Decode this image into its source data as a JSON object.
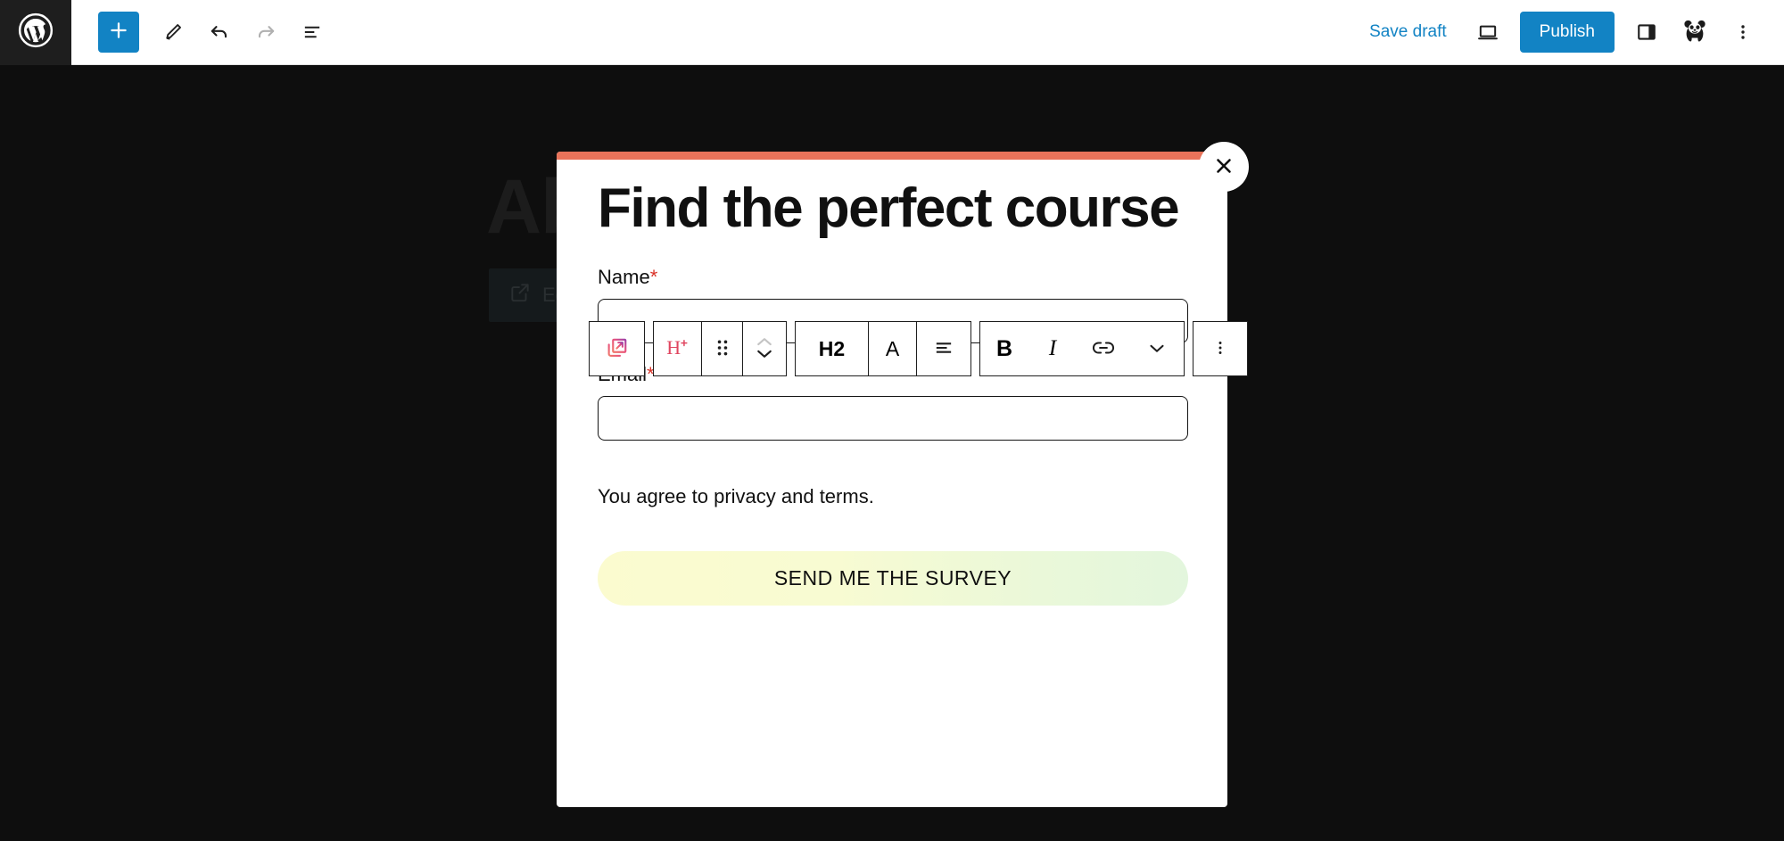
{
  "admin_bar": {
    "logo_icon": "wordpress-logo-icon",
    "add_block_label": "+",
    "add_block_icon": "plus-icon",
    "tools": [
      {
        "name": "edit-tool-button",
        "icon": "pencil-icon",
        "title": "Tools"
      },
      {
        "name": "undo-button",
        "icon": "undo-arrow-icon",
        "title": "Undo"
      },
      {
        "name": "redo-button",
        "icon": "redo-arrow-icon",
        "title": "Redo",
        "disabled": true
      },
      {
        "name": "document-overview-button",
        "icon": "list-view-icon",
        "title": "Document Overview"
      }
    ],
    "save_draft_label": "Save draft",
    "preview_icon": "desktop-preview-icon",
    "publish_label": "Publish",
    "sidebar_toggle_icon": "sidebar-panel-icon",
    "avatar_icon": "panda-avatar-icon",
    "options_icon": "kebab-menu-icon"
  },
  "background": {
    "post_title": "Ab",
    "edit_button_label": "Edi",
    "edit_button_icon": "external-link-icon"
  },
  "block_toolbar": {
    "items": [
      {
        "name": "popup-block-button",
        "icon": "popup-external-link-icon",
        "label": ""
      },
      {
        "name": "block-type-heading-button",
        "icon": "heading-plus-icon",
        "label": ""
      },
      {
        "name": "drag-handle-button",
        "icon": "drag-dots-icon",
        "label": ""
      },
      {
        "name": "move-block-button",
        "icon": "move-up-down-chevrons-icon",
        "label": ""
      },
      {
        "name": "heading-level-button",
        "icon": "",
        "label": "H2"
      },
      {
        "name": "text-color-button",
        "icon": "",
        "label": "A"
      },
      {
        "name": "align-text-button",
        "icon": "align-left-icon",
        "label": ""
      },
      {
        "name": "bold-button",
        "icon": "",
        "label": "B"
      },
      {
        "name": "italic-button",
        "icon": "",
        "label": "I"
      },
      {
        "name": "link-button",
        "icon": "link-icon",
        "label": ""
      },
      {
        "name": "more-formatting-button",
        "icon": "chevron-down-icon",
        "label": ""
      },
      {
        "name": "block-options-button",
        "icon": "kebab-menu-icon",
        "label": ""
      }
    ]
  },
  "modal": {
    "accent_color": "#e8735a",
    "close_icon": "close-x-icon",
    "heading": "Find the perfect course",
    "subtext": "",
    "fields": [
      {
        "name": "name-field",
        "label": "Name",
        "required": true,
        "required_mark": "*",
        "value": "",
        "placeholder": ""
      },
      {
        "name": "email-field",
        "label": "Email",
        "required": true,
        "required_mark": "*",
        "value": "",
        "placeholder": ""
      }
    ],
    "privacy_text": "You agree to privacy and terms.",
    "submit_label": "SEND ME THE SURVEY",
    "submit_gradient_from": "#fbfbcf",
    "submit_gradient_to": "#e3f6dd"
  },
  "colors": {
    "accent_blue": "#1283c4",
    "modal_accent": "#e8735a",
    "page_background": "#0e0e0e",
    "required_red": "#d93025",
    "heading_icon_red": "#e0455f"
  }
}
